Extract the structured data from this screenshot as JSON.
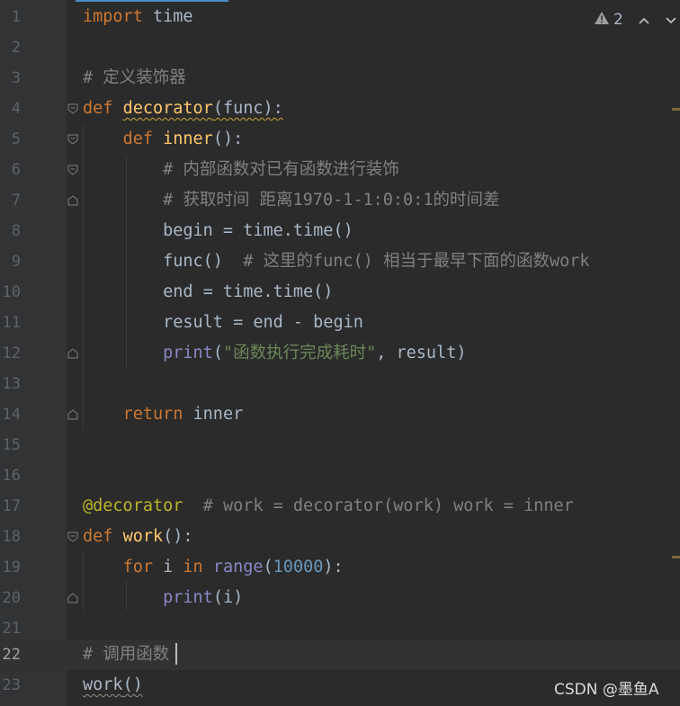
{
  "editor": {
    "inspections": {
      "warning_count": "2"
    },
    "watermark": "CSDN @墨鱼A",
    "colors": {
      "background": "#2b2b2b",
      "keyword": "#cc7832",
      "function": "#ffc66d",
      "comment": "#808080",
      "string": "#6a8759",
      "builtin": "#8888c6",
      "number": "#6897bb",
      "decorator": "#bbb529"
    },
    "lines": [
      {
        "num": "1",
        "t": [
          "import",
          " time"
        ]
      },
      {
        "num": "2",
        "t": []
      },
      {
        "num": "3",
        "t": [
          "# 定义装饰器"
        ]
      },
      {
        "num": "4",
        "t": [
          "def",
          " ",
          "decorator",
          "(func):"
        ]
      },
      {
        "num": "5",
        "t": [
          "    ",
          "def",
          " ",
          "inner",
          "():"
        ]
      },
      {
        "num": "6",
        "t": [
          "        ",
          "# 内部函数对已有函数进行装饰"
        ]
      },
      {
        "num": "7",
        "t": [
          "        ",
          "# 获取时间 距离1970-1-1:0:0:1的时间差"
        ]
      },
      {
        "num": "8",
        "t": [
          "        begin = time.time()"
        ]
      },
      {
        "num": "9",
        "t": [
          "        func()  ",
          "# 这里的func() 相当于最早下面的函数work"
        ]
      },
      {
        "num": "10",
        "t": [
          "        end = time.time()"
        ]
      },
      {
        "num": "11",
        "t": [
          "        result = end - begin"
        ]
      },
      {
        "num": "12",
        "t": [
          "        ",
          "print",
          "(",
          "\"函数执行完成耗时\"",
          ", result)"
        ]
      },
      {
        "num": "13",
        "t": []
      },
      {
        "num": "14",
        "t": [
          "    ",
          "return",
          " inner"
        ]
      },
      {
        "num": "15",
        "t": []
      },
      {
        "num": "16",
        "t": []
      },
      {
        "num": "17",
        "t": [
          "@decorator",
          "  ",
          "# work = decorator(work) work = inner"
        ]
      },
      {
        "num": "18",
        "t": [
          "def",
          " ",
          "work",
          "():"
        ]
      },
      {
        "num": "19",
        "t": [
          "    ",
          "for",
          " i ",
          "in",
          " ",
          "range",
          "(",
          "10000",
          "):"
        ]
      },
      {
        "num": "20",
        "t": [
          "        ",
          "print",
          "(i)"
        ]
      },
      {
        "num": "21",
        "t": []
      },
      {
        "num": "22",
        "t": [
          "# 调用函数"
        ]
      },
      {
        "num": "23",
        "t": [
          "work",
          "()"
        ]
      }
    ]
  }
}
